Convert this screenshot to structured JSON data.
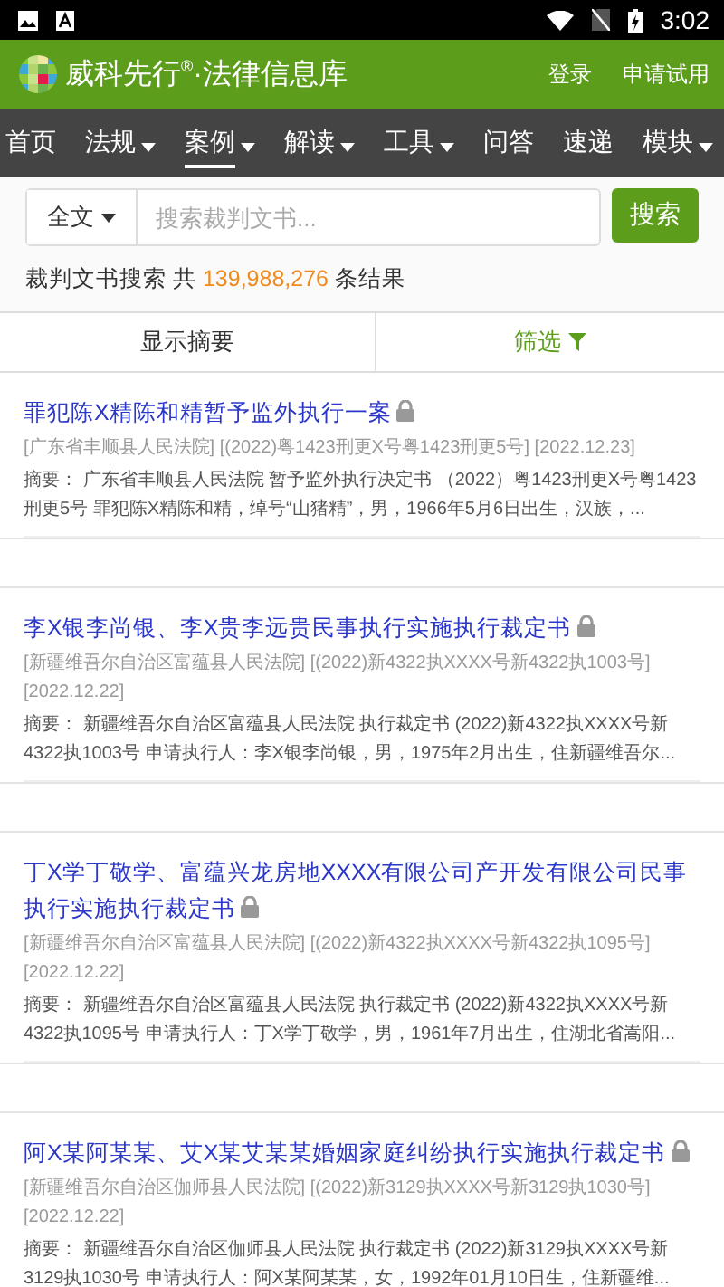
{
  "status_bar": {
    "time": "3:02"
  },
  "header": {
    "brand": "威科先行",
    "brand_mark": "®",
    "subtitle": "·法律信息库",
    "links": [
      "登录",
      "申请试用"
    ]
  },
  "nav": [
    {
      "label": "首页",
      "dropdown": false,
      "selected": false
    },
    {
      "label": "法规",
      "dropdown": true,
      "selected": false
    },
    {
      "label": "案例",
      "dropdown": true,
      "selected": true
    },
    {
      "label": "解读",
      "dropdown": true,
      "selected": false
    },
    {
      "label": "工具",
      "dropdown": true,
      "selected": false
    },
    {
      "label": "问答",
      "dropdown": false,
      "selected": false
    },
    {
      "label": "速递",
      "dropdown": false,
      "selected": false
    },
    {
      "label": "模块",
      "dropdown": true,
      "selected": false
    }
  ],
  "search": {
    "scope": "全文",
    "placeholder": "搜索裁判文书...",
    "button": "搜索"
  },
  "result_summary": {
    "prefix": "裁判文书搜索 共",
    "count": "139,988,276",
    "suffix": "条结果"
  },
  "toolbar": {
    "summary_toggle": "显示摘要",
    "filter": "筛选"
  },
  "results": [
    {
      "title": "罪犯陈X精陈和精暂予监外执行一案",
      "locked": true,
      "meta": "[广东省丰顺县人民法院] [(2022)粤1423刑更X号粤1423刑更5号] [2022.12.23]",
      "summary": "摘要： 广东省丰顺县人民法院 暂予监外执行决定书 （2022）粤1423刑更X号粤1423刑更5号 罪犯陈X精陈和精，绰号“山猪精”，男，1966年5月6日出生，汉族，..."
    },
    {
      "title": "李X银李尚银、李X贵李远贵民事执行实施执行裁定书",
      "locked": true,
      "meta": "[新疆维吾尔自治区富蕴县人民法院] [(2022)新4322执XXXX号新4322执1003号] [2022.12.22]",
      "summary": "摘要： 新疆维吾尔自治区富蕴县人民法院 执行裁定书 (2022)新4322执XXXX号新4322执1003号 申请执行人：李X银李尚银，男，1975年2月出生，住新疆维吾尔..."
    },
    {
      "title": "丁X学丁敬学、富蕴兴龙房地XXXX有限公司产开发有限公司民事执行实施执行裁定书",
      "locked": true,
      "meta": "[新疆维吾尔自治区富蕴县人民法院] [(2022)新4322执XXXX号新4322执1095号] [2022.12.22]",
      "summary": "摘要： 新疆维吾尔自治区富蕴县人民法院 执行裁定书 (2022)新4322执XXXX号新4322执1095号 申请执行人：丁X学丁敬学，男，1961年7月出生，住湖北省嵩阳..."
    },
    {
      "title": "阿X某阿某某、艾X某艾某某婚姻家庭纠纷执行实施执行裁定书",
      "locked": true,
      "meta": "[新疆维吾尔自治区伽师县人民法院] [(2022)新3129执XXXX号新3129执1030号] [2022.12.22]",
      "summary": "摘要： 新疆维吾尔自治区伽师县人民法院 执行裁定书 (2022)新3129执XXXX号新3129执1030号 申请执行人：阿X某阿某某，女，1992年01月10日生，住新疆维..."
    }
  ]
}
